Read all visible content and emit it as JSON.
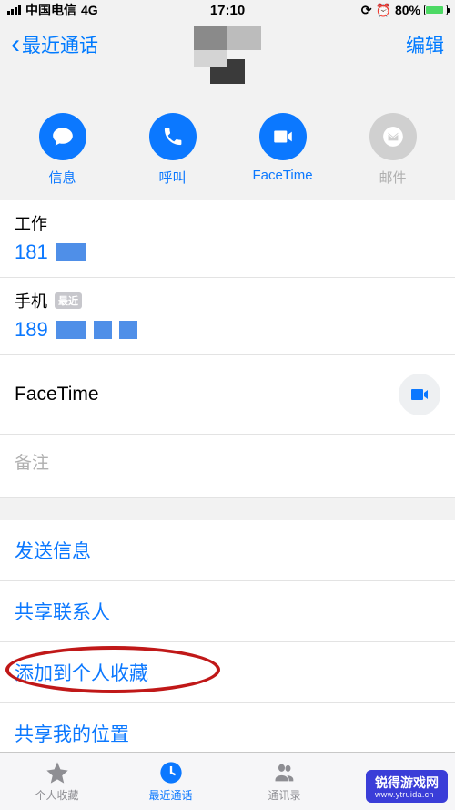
{
  "status": {
    "carrier": "中国电信",
    "network": "4G",
    "time": "17:10",
    "battery": "80%"
  },
  "nav": {
    "back": "最近通话",
    "edit": "编辑"
  },
  "actions": {
    "message": "信息",
    "call": "呼叫",
    "facetime": "FaceTime",
    "mail": "邮件"
  },
  "phones": {
    "work_label": "工作",
    "work_number": "181",
    "mobile_label": "手机",
    "recent_badge": "最近",
    "mobile_number": "189"
  },
  "facetime": {
    "label": "FaceTime"
  },
  "notes": {
    "label": "备注"
  },
  "links": {
    "send_message": "发送信息",
    "share_contact": "共享联系人",
    "add_favorite": "添加到个人收藏",
    "share_location": "共享我的位置"
  },
  "tabs": {
    "favorites": "个人收藏",
    "recents": "最近通话",
    "contacts": "通讯录"
  },
  "watermark": {
    "title": "锐得游戏网",
    "url": "www.ytruida.cn"
  }
}
